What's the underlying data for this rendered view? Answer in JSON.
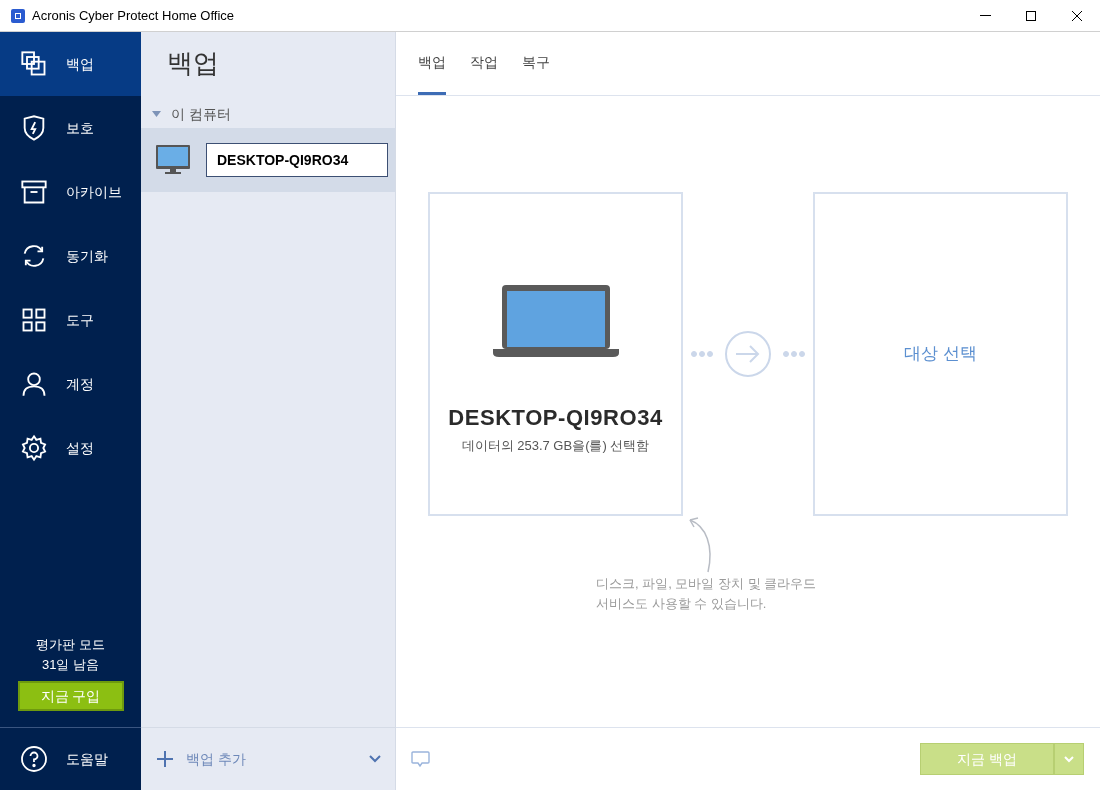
{
  "window": {
    "title": "Acronis Cyber Protect Home Office"
  },
  "nav": [
    {
      "kind": "backup",
      "label": "백업",
      "selected": true
    },
    {
      "kind": "protection",
      "label": "보호",
      "selected": false
    },
    {
      "kind": "archive",
      "label": "아카이브",
      "selected": false
    },
    {
      "kind": "sync",
      "label": "동기화",
      "selected": false
    },
    {
      "kind": "tools",
      "label": "도구",
      "selected": false
    },
    {
      "kind": "account",
      "label": "계정",
      "selected": false
    },
    {
      "kind": "settings",
      "label": "설정",
      "selected": false
    }
  ],
  "trial": {
    "mode": "평가판 모드",
    "remaining": "31일 남음",
    "buy_button": "지금 구입"
  },
  "help": {
    "label": "도움말"
  },
  "backup_list": {
    "title": "백업",
    "group": {
      "label": "이 컴퓨터",
      "expanded": true,
      "items": [
        {
          "name": "DESKTOP-QI9RO34",
          "selected": true
        }
      ]
    },
    "add_button": "백업 추가"
  },
  "tabs": [
    {
      "label": "백업",
      "selected": true
    },
    {
      "label": "작업",
      "selected": false
    },
    {
      "label": "복구",
      "selected": false
    }
  ],
  "source": {
    "name": "DESKTOP-QI9RO34",
    "detail": "데이터의 253.7 GB을(를) 선택함"
  },
  "destination": {
    "label": "대상 선택"
  },
  "hint": {
    "line_1": "디스크, 파일, 모바일 장치 및 클라우드",
    "line_2": "서비스도 사용할 수 있습니다."
  },
  "backup_now_button": {
    "label": "지금 백업",
    "disabled": true
  }
}
